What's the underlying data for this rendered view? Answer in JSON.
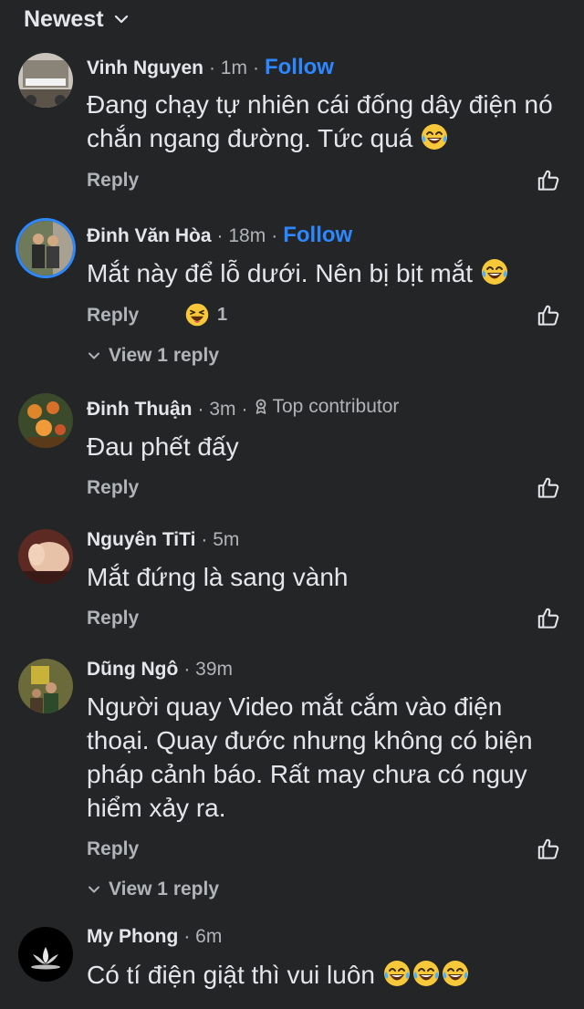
{
  "sort": {
    "label": "Newest",
    "icon": "chevron-down-icon"
  },
  "labels": {
    "reply": "Reply",
    "follow": "Follow"
  },
  "comments": [
    {
      "name": "Vinh Nguyen",
      "time": "1m",
      "text": "Đang chạy tự nhiên cái đống dây điện nó chắn ngang đường. Tức quá"
    },
    {
      "name": "Đinh Văn Hòa",
      "time": "18m",
      "text": "Mắt này để lỗ dưới. Nên bị bịt mắt",
      "reaction_count": "1",
      "view_replies": "View 1 reply"
    },
    {
      "name": "Đinh Thuận",
      "time": "3m",
      "badge": "Top contributor",
      "text": "Đau phết đấy"
    },
    {
      "name": "Nguyên TiTi",
      "time": "5m",
      "text": "Mắt đứng là sang vành"
    },
    {
      "name": "Dũng Ngô",
      "time": "39m",
      "text": "Người quay Video mắt cắm vào điện thoại. Quay đước nhưng không có biện pháp cảnh báo. Rất may chưa có nguy hiểm xảy ra.",
      "view_replies": "View 1 reply"
    },
    {
      "name": "My Phong",
      "time": "6m",
      "text": "Có tí điện giật thì vui luôn"
    }
  ]
}
